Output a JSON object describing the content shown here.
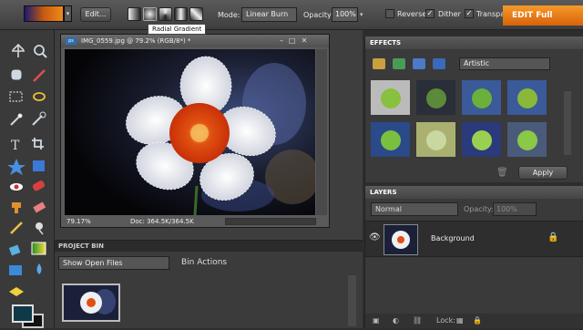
{
  "options_bar": {
    "edit_label": "Edit...",
    "tooltip": "Radial Gradient",
    "mode_label": "Mode:",
    "mode_value": "Linear Burn",
    "opacity_label": "Opacity:",
    "opacity_value": "100%",
    "reverse_label": "Reverse",
    "dither_label": "Dither",
    "transparency_label": "Transpar",
    "edit_full_label": "EDIT Full",
    "reverse_checked": false,
    "dither_checked": true,
    "transparency_checked": true
  },
  "document": {
    "title": "IMG_0559.jpg @ 79.2% (RGB/8*) *",
    "badge": "ps",
    "zoom": "79.17%",
    "doc_size": "Doc: 364.5K/364.5K"
  },
  "project_bin": {
    "header": "PROJECT BIN",
    "show_select": "Show Open Files",
    "bin_actions": "Bin Actions"
  },
  "effects": {
    "header": "EFFECTS",
    "category": "Artistic",
    "apply_label": "Apply"
  },
  "layers": {
    "header": "LAYERS",
    "blend_mode": "Normal",
    "opacity_label": "Opacity:",
    "opacity_value": "100%",
    "layer_name": "Background",
    "lock_label": "Lock:"
  },
  "colors": {
    "accent": "#e8760e",
    "foreground": "#0e3a48",
    "background": "#111111"
  }
}
